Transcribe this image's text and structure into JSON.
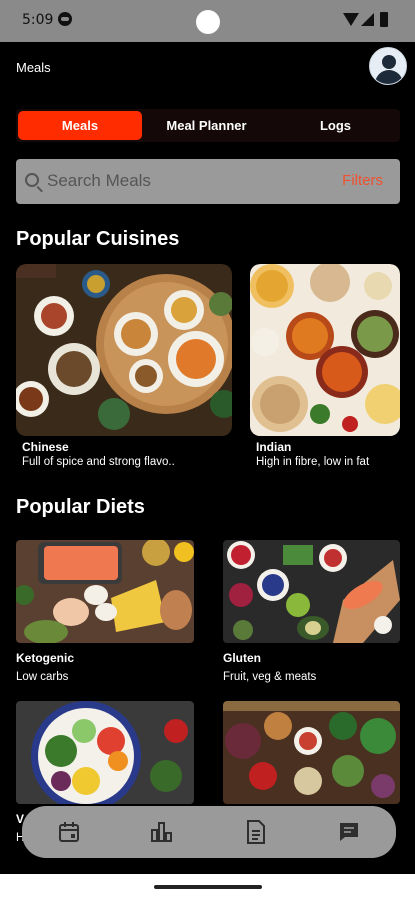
{
  "status": {
    "time": "5:09"
  },
  "header": {
    "title": "Meals"
  },
  "tabs": [
    {
      "label": "Meals",
      "active": true
    },
    {
      "label": "Meal Planner",
      "active": false
    },
    {
      "label": "Logs",
      "active": false
    }
  ],
  "search": {
    "placeholder": "Search Meals",
    "filters_label": "Filters"
  },
  "cuisines": {
    "title": "Popular Cuisines",
    "items": [
      {
        "name": "Chinese",
        "description": "Full of spice and strong flavo.."
      },
      {
        "name": "Indian",
        "description": "High in fibre, low in fat"
      }
    ]
  },
  "diets": {
    "title": "Popular Diets",
    "items": [
      {
        "name": "Ketogenic",
        "description": "Low carbs"
      },
      {
        "name": "Gluten",
        "description": "Fruit, veg & meats"
      },
      {
        "name": "V",
        "description": "H"
      }
    ]
  },
  "nav": {
    "items": [
      "calendar-icon",
      "bar-chart-icon",
      "document-icon",
      "chat-icon"
    ]
  },
  "colors": {
    "accent": "#ff2c00",
    "filters": "#f0522f",
    "background": "#000000",
    "input_bg": "#9a9a9a"
  }
}
